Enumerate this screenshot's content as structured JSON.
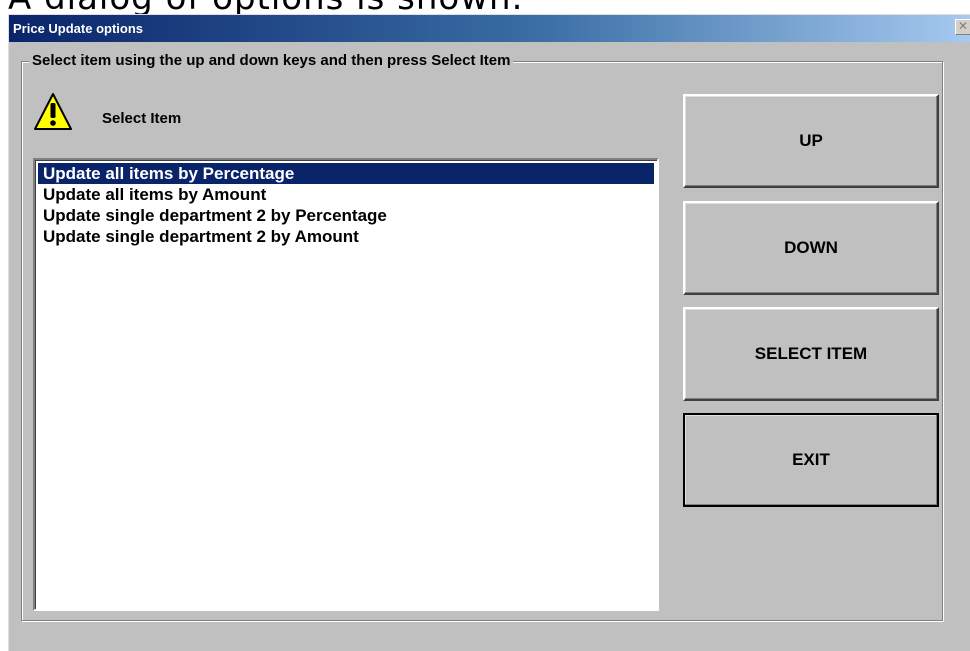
{
  "caption": "A dialog of options is shown.",
  "window": {
    "title": "Price Update options",
    "close_glyph": "✕"
  },
  "group": {
    "legend": "Select item using the up and down keys and then press Select Item"
  },
  "select_label": "Select Item",
  "warning_icon": "warning-triangle-exclamation",
  "list": {
    "items": [
      {
        "label": "Update all items by Percentage",
        "selected": true
      },
      {
        "label": "Update all items by Amount",
        "selected": false
      },
      {
        "label": "Update single department 2 by Percentage",
        "selected": false
      },
      {
        "label": "Update single department 2 by Amount",
        "selected": false
      }
    ]
  },
  "buttons": {
    "up": "UP",
    "down": "DOWN",
    "select_item": "SELECT ITEM",
    "exit": "EXIT"
  },
  "colors": {
    "selection": "#0a246a",
    "dialog_face": "#c0c0c0",
    "warning_yellow": "#ffff00"
  }
}
